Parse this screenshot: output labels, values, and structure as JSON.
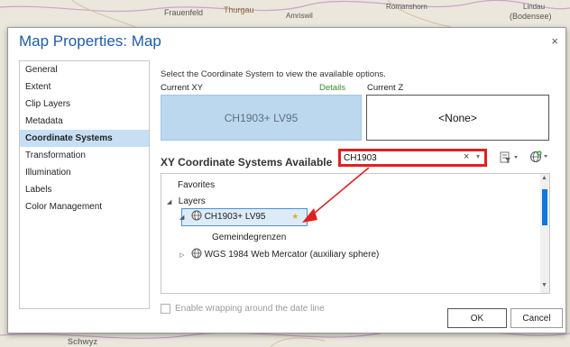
{
  "map": {
    "labels": [
      "Frauenfeld",
      "Thurgau",
      "Amriswil",
      "Romanshorn",
      "Lindau",
      "(Bodensee)",
      "Schwyz"
    ]
  },
  "dialog": {
    "title": "Map Properties: Map",
    "close_glyph": "×",
    "sidebar": {
      "items": [
        {
          "label": "General"
        },
        {
          "label": "Extent"
        },
        {
          "label": "Clip Layers"
        },
        {
          "label": "Metadata"
        },
        {
          "label": "Coordinate Systems",
          "selected": true
        },
        {
          "label": "Transformation"
        },
        {
          "label": "Illumination"
        },
        {
          "label": "Labels"
        },
        {
          "label": "Color Management"
        }
      ]
    },
    "content": {
      "instruction": "Select the Coordinate System to view the available options.",
      "current_xy_label": "Current XY",
      "details_link": "Details",
      "current_z_label": "Current Z",
      "current_xy_value": "CH1903+ LV95",
      "current_z_value": "<None>",
      "available_label": "XY Coordinate Systems Available",
      "search": {
        "value": "CH1903",
        "clear_glyph": "×"
      },
      "toolbar": {
        "filter_icon": "filter-icon",
        "globe_icon": "add-coordinate-system-icon"
      },
      "tree": {
        "favorites": "Favorites",
        "layers": "Layers",
        "selected_cs": "CH1903+ LV95",
        "layer_name": "Gemeindegrenzen",
        "next_cs": "WGS 1984 Web Mercator (auxiliary sphere)"
      },
      "wrap_option": "Enable wrapping around the date line"
    },
    "buttons": {
      "ok": "OK",
      "cancel": "Cancel"
    },
    "colors": {
      "accent": "#1e5da8",
      "highlight": "#e02020",
      "selection": "#c7dff4"
    }
  }
}
